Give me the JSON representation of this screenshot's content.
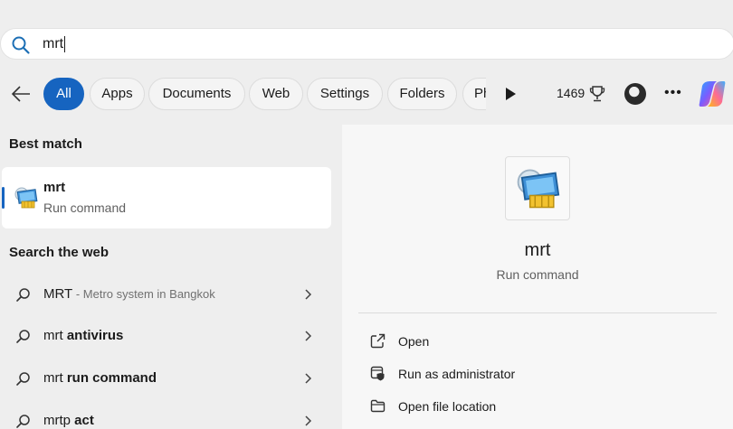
{
  "search": {
    "value": "mrt"
  },
  "filters": {
    "chips": [
      {
        "label": "All",
        "active": true
      },
      {
        "label": "Apps",
        "active": false
      },
      {
        "label": "Documents",
        "active": false
      },
      {
        "label": "Web",
        "active": false
      },
      {
        "label": "Settings",
        "active": false
      },
      {
        "label": "Folders",
        "active": false
      },
      {
        "label": "Photos",
        "active": false
      }
    ],
    "points": "1469"
  },
  "best_match": {
    "heading": "Best match",
    "title": "mrt",
    "subtitle": "Run command"
  },
  "web": {
    "heading": "Search the web",
    "results": [
      {
        "prefix": "",
        "bold": "MRT",
        "desc": " - Metro system in Bangkok"
      },
      {
        "prefix": "mrt ",
        "bold": "antivirus",
        "desc": ""
      },
      {
        "prefix": "mrt ",
        "bold": "run command",
        "desc": ""
      },
      {
        "prefix": "mrtp ",
        "bold": "act",
        "desc": ""
      }
    ]
  },
  "preview": {
    "title": "mrt",
    "subtitle": "Run command",
    "actions": [
      {
        "label": "Open",
        "icon": "open-external-icon"
      },
      {
        "label": "Run as administrator",
        "icon": "shield-icon"
      },
      {
        "label": "Open file location",
        "icon": "folder-icon"
      }
    ]
  },
  "colors": {
    "accent": "#1664c0"
  }
}
